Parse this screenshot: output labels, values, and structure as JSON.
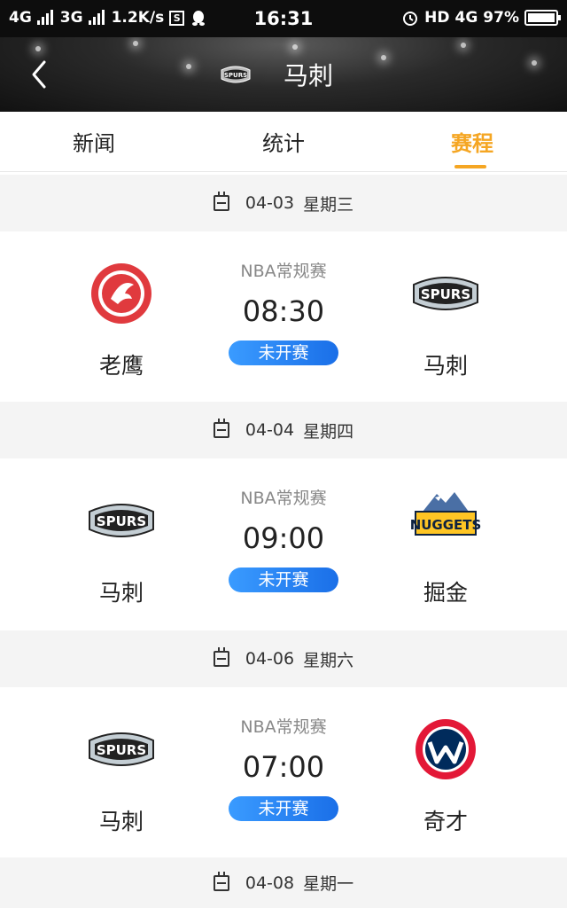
{
  "status_bar": {
    "network1": "4G",
    "network2": "3G",
    "speed": "1.2K/s",
    "time": "16:31",
    "hd": "HD",
    "network3": "4G",
    "battery": "97%"
  },
  "header": {
    "title": "马刺"
  },
  "tabs": [
    {
      "label": "新闻"
    },
    {
      "label": "统计"
    },
    {
      "label": "赛程"
    }
  ],
  "active_tab": "赛程",
  "accent_color": "#f5a623",
  "schedule": [
    {
      "date": "04-03",
      "weekday": "星期三",
      "league": "NBA常规赛",
      "time": "08:30",
      "status": "未开赛",
      "home": {
        "name": "老鹰",
        "logo": "hawks-logo"
      },
      "away": {
        "name": "马刺",
        "logo": "spurs-logo"
      }
    },
    {
      "date": "04-04",
      "weekday": "星期四",
      "league": "NBA常规赛",
      "time": "09:00",
      "status": "未开赛",
      "home": {
        "name": "马刺",
        "logo": "spurs-logo"
      },
      "away": {
        "name": "掘金",
        "logo": "nuggets-logo"
      }
    },
    {
      "date": "04-06",
      "weekday": "星期六",
      "league": "NBA常规赛",
      "time": "07:00",
      "status": "未开赛",
      "home": {
        "name": "马刺",
        "logo": "spurs-logo"
      },
      "away": {
        "name": "奇才",
        "logo": "wizards-logo"
      }
    },
    {
      "date": "04-08",
      "weekday": "星期一"
    }
  ]
}
